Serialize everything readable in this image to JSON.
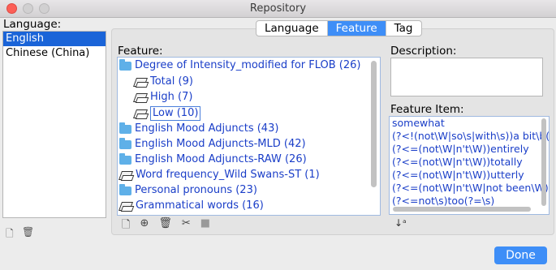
{
  "window": {
    "title": "Repository"
  },
  "language": {
    "label": "Language:",
    "items": [
      {
        "label": "English",
        "selected": true
      },
      {
        "label": "Chinese (China)",
        "selected": false
      }
    ]
  },
  "tabs": [
    {
      "label": "Language",
      "active": false
    },
    {
      "label": "Feature",
      "active": true
    },
    {
      "label": "Tag",
      "active": false
    }
  ],
  "feature": {
    "label": "Feature:",
    "tree": [
      {
        "label": "Degree of Intensity_modified for FLOB (26)",
        "icon": "folder-icon"
      },
      {
        "label": "Total (9)",
        "icon": "book-icon"
      },
      {
        "label": "High (7)",
        "icon": "book-icon"
      },
      {
        "label": "Low (10)",
        "icon": "book-icon"
      },
      {
        "label": "English Mood Adjuncts (43)",
        "icon": "folder-icon"
      },
      {
        "label": "English Mood Adjuncts-MLD (42)",
        "icon": "folder-icon"
      },
      {
        "label": "English Mood Adjuncts-RAW (26)",
        "icon": "folder-icon"
      },
      {
        "label": "Word frequency_Wild Swans-ST (1)",
        "icon": "book-icon"
      },
      {
        "label": "Personal pronouns (23)",
        "icon": "folder-icon"
      },
      {
        "label": "Grammatical words (16)",
        "icon": "book-icon"
      }
    ]
  },
  "description": {
    "label": "Description:"
  },
  "feature_item": {
    "label": "Feature Item:",
    "lines": [
      "somewhat",
      "(?<!(not\\W|so\\s|with\\s))a bit\\b(",
      "(?<=(not\\W|n't\\W))entirely",
      "(?<=(not\\W|n't\\W))totally",
      "(?<=(not\\W|n't\\W))utterly",
      "(?<=(not\\W|n't\\W|not been\\W))·",
      "(?<=not\\s)too(?=\\s)"
    ]
  },
  "buttons": {
    "done": "Done"
  },
  "colors": {
    "accent": "#3e8ef7",
    "selection": "#1a64d8",
    "tree_text": "#1a3ec8",
    "close": "#fc5f57"
  }
}
